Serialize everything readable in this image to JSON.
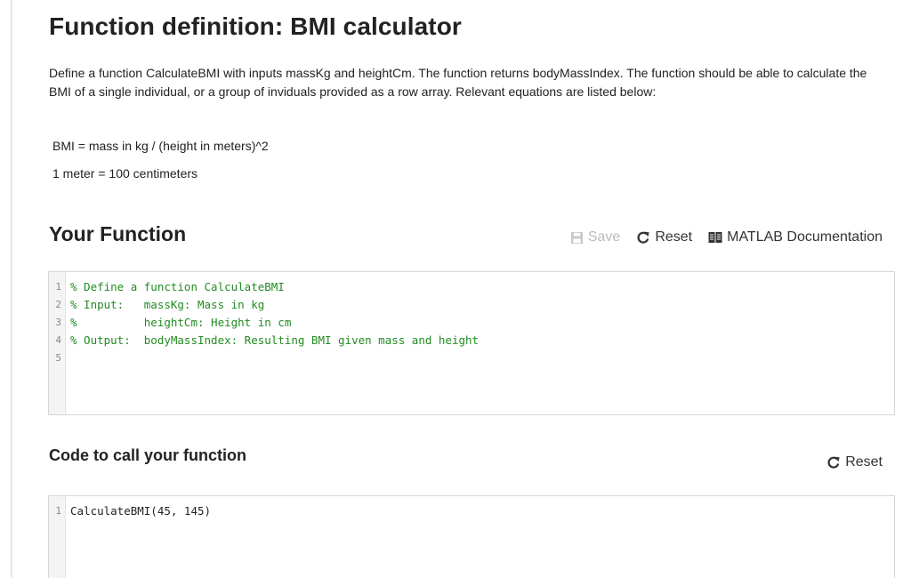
{
  "header": {
    "title": "Function definition: BMI calculator"
  },
  "description": {
    "text": "Define a function CalculateBMI with inputs massKg and heightCm. The function returns bodyMassIndex. The function should be able to calculate the BMI of a single individual, or a group of inviduals provided as a row array. Relevant equations are listed below:",
    "equation_1": "BMI = mass in kg / (height in meters)^2",
    "equation_2": "1 meter = 100 centimeters"
  },
  "your_function": {
    "title": "Your Function",
    "save_label": "Save",
    "reset_label": "Reset",
    "docs_label": "MATLAB Documentation",
    "lines": [
      {
        "num": "1",
        "text": "% Define a function CalculateBMI"
      },
      {
        "num": "2",
        "text": "% Input:   massKg: Mass in kg"
      },
      {
        "num": "3",
        "text": "%          heightCm: Height in cm"
      },
      {
        "num": "4",
        "text": "% Output:  bodyMassIndex: Resulting BMI given mass and height"
      },
      {
        "num": "5",
        "text": ""
      }
    ]
  },
  "call_code": {
    "title": "Code to call your function",
    "reset_label": "Reset",
    "lines": [
      {
        "num": "1",
        "text": "CalculateBMI(45, 145)"
      }
    ]
  },
  "icons": {
    "save": "floppy-disk-icon",
    "reset": "circular-arrow-icon",
    "docs": "book-icon"
  },
  "colors": {
    "comment": "#228b22",
    "disabled": "#bbbbbb",
    "text": "#222222"
  }
}
